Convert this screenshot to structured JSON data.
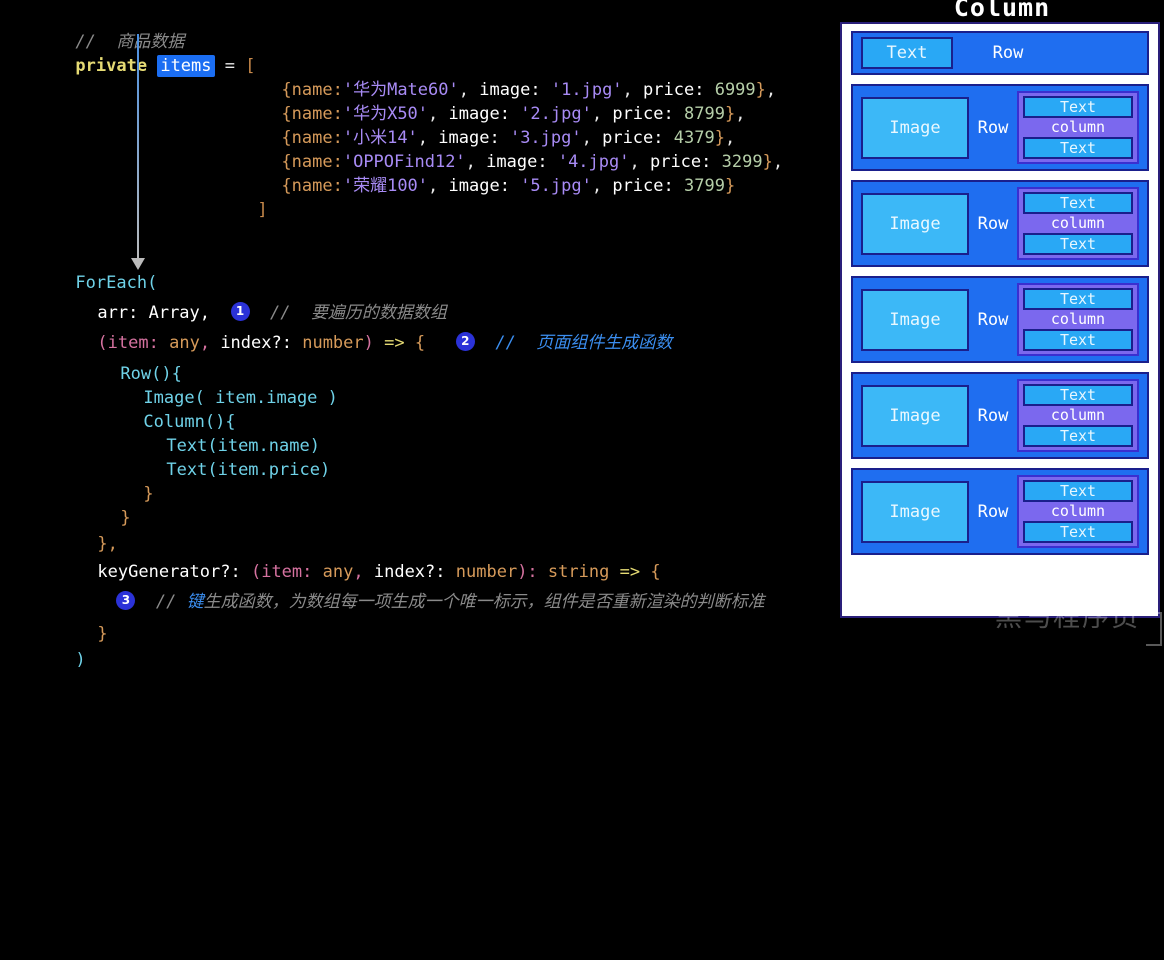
{
  "editor": {
    "comment_data": "//  商品数据",
    "decl": {
      "keyword": "private",
      "name": "items",
      "eq": "=",
      "bracket": "["
    },
    "items": [
      {
        "name": "'华为Mate60'",
        "image": "'1.jpg'",
        "price": "6999"
      },
      {
        "name": "'华为X50'",
        "image": "'2.jpg'",
        "price": "8799"
      },
      {
        "name": "'小米14'",
        "image": "'3.jpg'",
        "price": "4379"
      },
      {
        "name": "'OPPOFind12'",
        "image": "'4.jpg'",
        "price": "3299"
      },
      {
        "name": "'荣耀100'",
        "image": "'5.jpg'",
        "price": "3799"
      }
    ],
    "item_labels": {
      "name_key": "{name:",
      "image_key": "image:",
      "price_key": "price:"
    },
    "close_bracket": "]",
    "foreach_open": "ForEach(",
    "param1": {
      "text": "arr: Array,",
      "badge": "1",
      "comment": "//  要遍历的数据数组"
    },
    "param2": {
      "open": "(item:",
      "any": "any",
      "comma": ",",
      "index": "index?:",
      "number": "number",
      "close": ")",
      "arrow": "=>",
      "brace": "{",
      "badge": "2",
      "comment": "//  页面组件生成函数"
    },
    "body": {
      "row": "Row(){",
      "image": "Image( item.image )",
      "column": "Column(){",
      "text_name": "Text(item.name)",
      "text_price": "Text(item.price)",
      "close_col": "}",
      "close_row": "}",
      "close_fn": "},"
    },
    "keygen": {
      "label": "keyGenerator?:",
      "open": "(item:",
      "any": "any",
      "comma": ",",
      "index": "index?:",
      "number": "number",
      "close": "):",
      "ret": "string",
      "arrow": "=>",
      "brace": "{"
    },
    "param3": {
      "badge": "3",
      "comment_head": "键",
      "comment_rest": "生成函数，为数组每一项生成一个唯一标示，组件是否重新渲染的判断标准"
    },
    "keygen_close": "}",
    "foreach_close": ")"
  },
  "diagram": {
    "title": "Column",
    "rows": [
      {
        "kind": "text-row",
        "text": "Text",
        "label": "Row"
      },
      {
        "kind": "image-row",
        "image": "Image",
        "label": "Row",
        "column_label": "column",
        "text_top": "Text",
        "text_bottom": "Text"
      },
      {
        "kind": "image-row",
        "image": "Image",
        "label": "Row",
        "column_label": "column",
        "text_top": "Text",
        "text_bottom": "Text"
      },
      {
        "kind": "image-row",
        "image": "Image",
        "label": "Row",
        "column_label": "column",
        "text_top": "Text",
        "text_bottom": "Text"
      },
      {
        "kind": "image-row",
        "image": "Image",
        "label": "Row",
        "column_label": "column",
        "text_top": "Text",
        "text_bottom": "Text"
      },
      {
        "kind": "image-row",
        "image": "Image",
        "label": "Row",
        "column_label": "column",
        "text_top": "Text",
        "text_bottom": "Text"
      }
    ],
    "watermark": "黑马程序员"
  },
  "colors": {
    "row_fill": "#1f6ef0",
    "text_fill": "#29a8f5",
    "image_fill": "#3cb8f7",
    "column_fill": "#7b68ee",
    "border": "#1a1f8c",
    "badge": "#2b32d8",
    "highlight": "#1b6ef3"
  }
}
